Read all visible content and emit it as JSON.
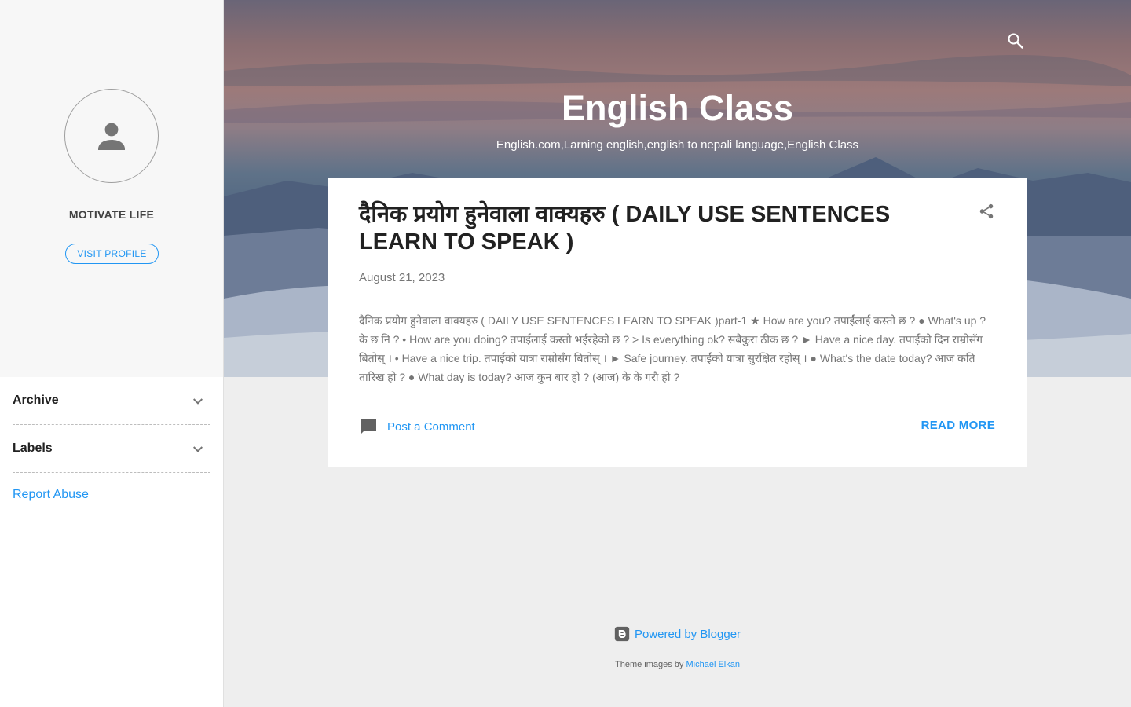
{
  "sidebar": {
    "profile_name": "MOTIVATE LIFE",
    "visit_profile": "VISIT PROFILE",
    "widgets": [
      {
        "title": "Archive"
      },
      {
        "title": "Labels"
      }
    ],
    "report_abuse": "Report Abuse"
  },
  "header": {
    "title": "English Class",
    "description": "English.com,Larning english,english to nepali language,English Class"
  },
  "post": {
    "title": "दैनिक प्रयोग हुनेवाला वाक्यहरु ( DAILY USE SENTENCES LEARN TO SPEAK )",
    "date": "August 21, 2023",
    "snippet": "दैनिक प्रयोग हुनेवाला वाक्यहरु ( DAILY USE SENTENCES LEARN TO SPEAK )part-1 ★ How are you? तपाईंलाई कस्तो छ ? ● What's up ? के छ नि ? • How are you doing? तपाईंलाई कस्तो भईरहेको छ ? > Is everything ok? सबैकुरा ठीक छ ? ► Have a nice day. तपाईंको दिन राम्रोसँग बितोस् । • Have a nice trip. तपाईंको यात्रा राम्रोसँग बितोस् । ► Safe journey. तपाईंको यात्रा सुरक्षित रहोस् । ● What's the date today? आज कति तारिख हो ? ● What day is today? आज कुन बार हो ? (आज) के के गरौ हो ?",
    "comment_link": "Post a Comment",
    "read_more": "READ MORE"
  },
  "footer": {
    "powered_by": "Powered by Blogger",
    "theme_images_prefix": "Theme images by",
    "theme_images_author": "Michael Elkan"
  },
  "colors": {
    "accent": "#2196f3",
    "sidebar_bg": "#f7f7f7",
    "page_bg": "#eeeeee"
  },
  "icons": [
    "person-icon",
    "search-icon",
    "share-icon",
    "chevron-down-icon",
    "comment-icon",
    "blogger-icon"
  ]
}
